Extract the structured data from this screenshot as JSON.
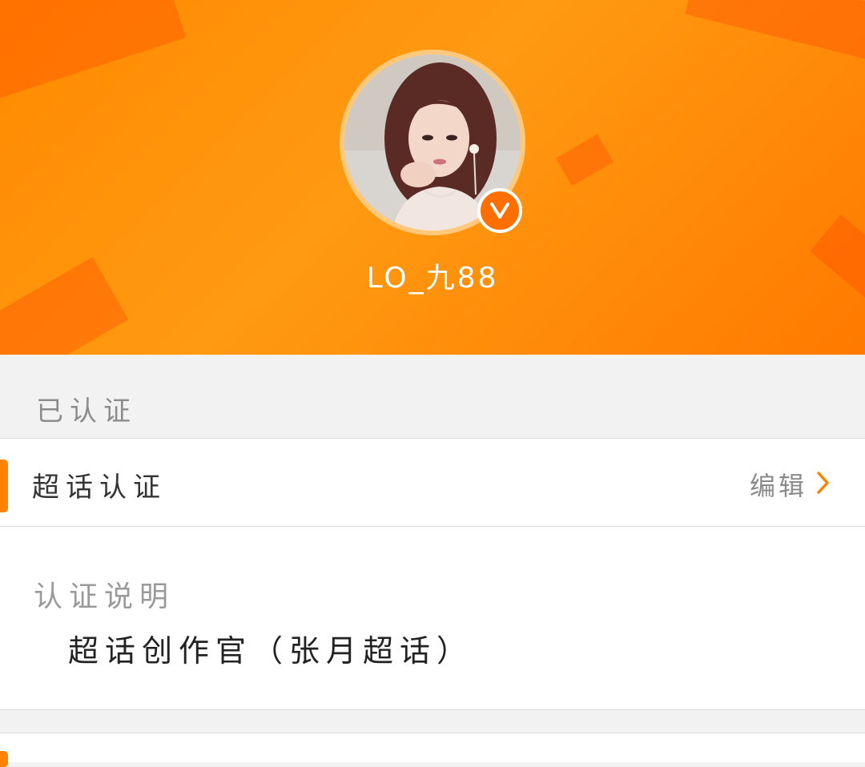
{
  "header": {
    "username": "LO_九88",
    "verified_icon": "verified-v-icon",
    "brand_color": "#ff8a00"
  },
  "verified_section": {
    "title": "已认证"
  },
  "certification_row": {
    "label": "超话认证",
    "edit_label": "编辑",
    "edit_icon": "chevron-right-icon"
  },
  "description": {
    "title": "认证说明",
    "text": "超话创作官（张月超话）"
  }
}
